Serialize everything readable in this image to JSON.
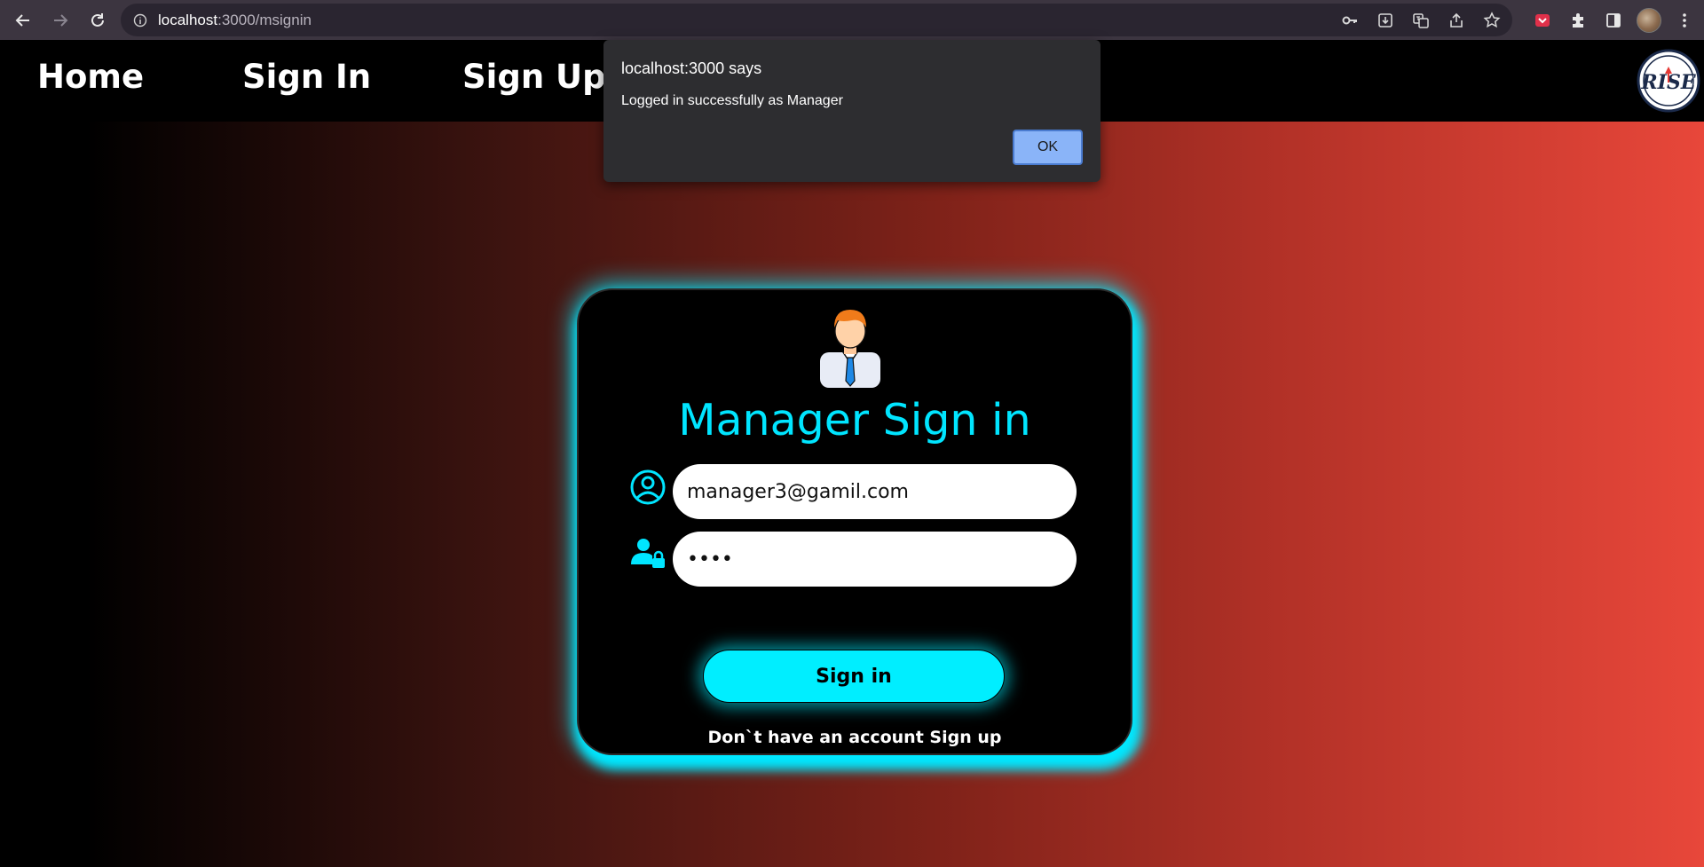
{
  "browser": {
    "url_host": "localhost",
    "url_path": ":3000/msignin"
  },
  "nav": {
    "home": "Home",
    "sign_in": "Sign In",
    "sign_up": "Sign Up"
  },
  "logo": {
    "text": "RISE"
  },
  "card": {
    "title": "Manager Sign in",
    "email_value": "manager3@gamil.com",
    "password_value": "1234",
    "submit_label": "Sign in",
    "signup_prompt": "Don`t have an account",
    "signup_link": "Sign up"
  },
  "dialog": {
    "title": "localhost:3000 says",
    "message": "Logged in successfully as Manager",
    "ok_label": "OK"
  },
  "colors": {
    "accent": "#00e5ff",
    "gradient_end": "#e8473a"
  }
}
